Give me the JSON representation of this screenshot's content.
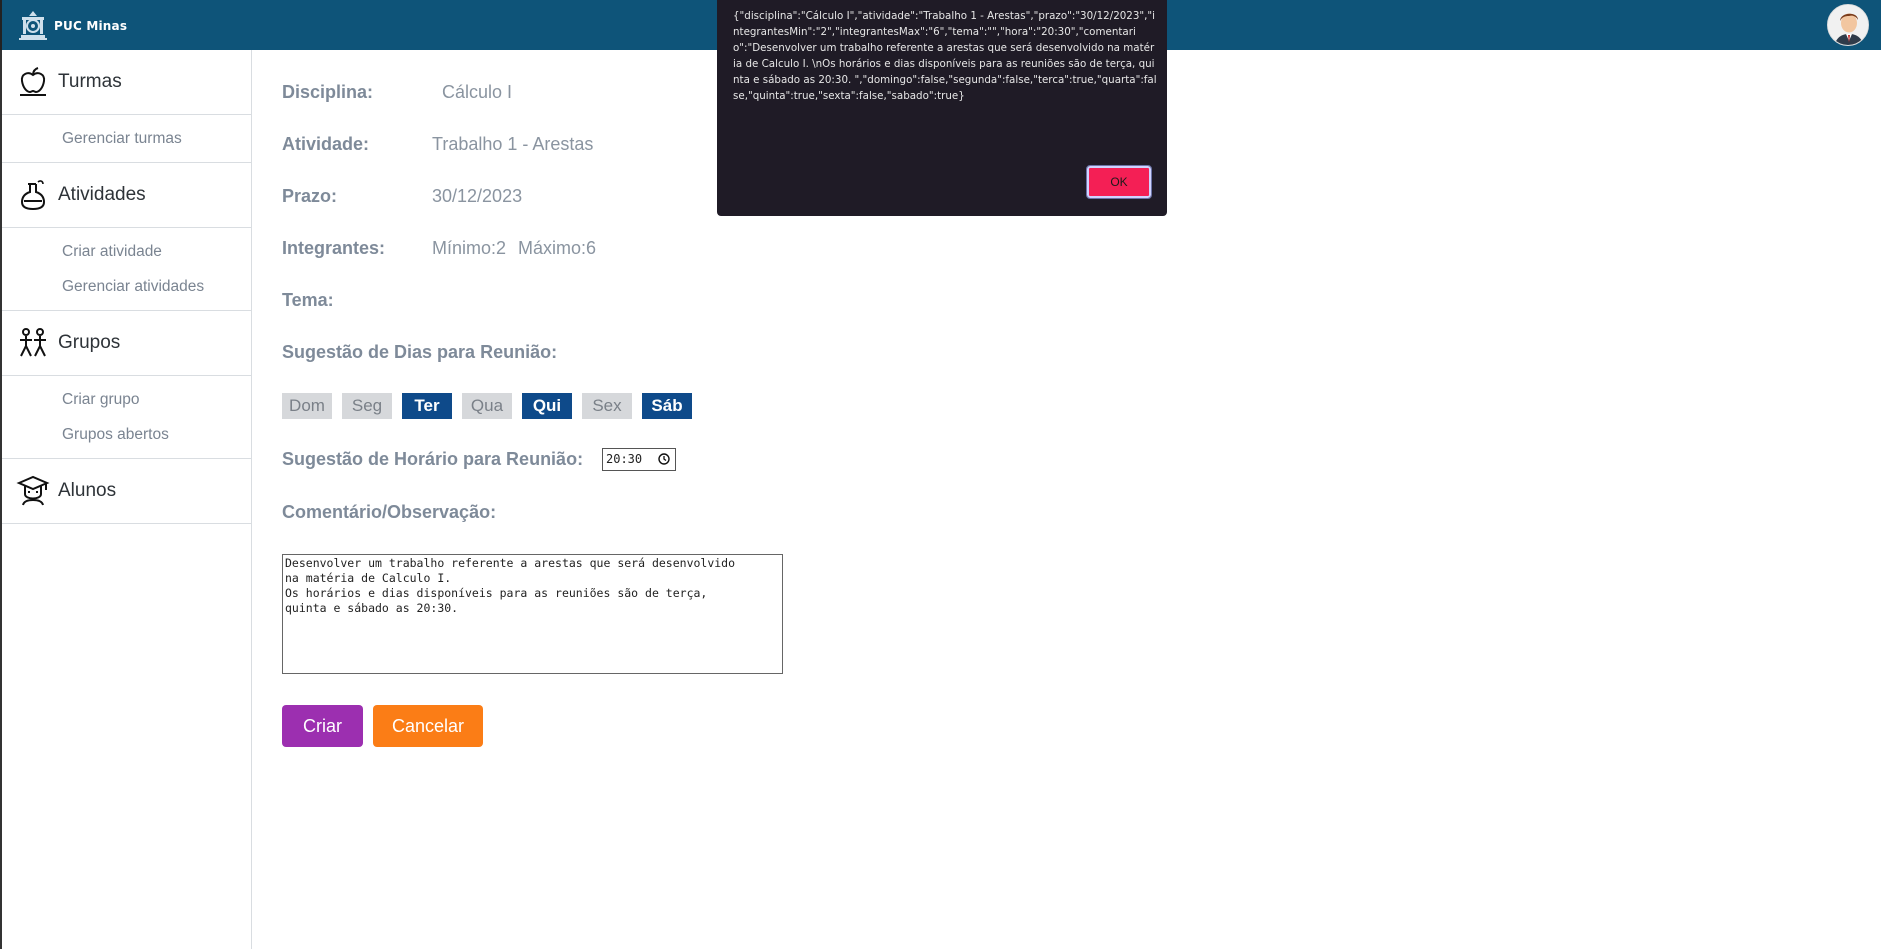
{
  "header": {
    "brand": "PUC Minas",
    "brand_logo": "puc-minas-crest-icon",
    "avatar": "user-avatar",
    "bar_color": "#0e5479"
  },
  "sidebar": {
    "sections": [
      {
        "label": "Turmas",
        "icon": "apple-icon",
        "items": [
          "Gerenciar turmas"
        ]
      },
      {
        "label": "Atividades",
        "icon": "flask-icon",
        "items": [
          "Criar atividade",
          "Gerenciar atividades"
        ]
      },
      {
        "label": "Grupos",
        "icon": "group-icon",
        "items": [
          "Criar grupo",
          "Grupos abertos"
        ]
      },
      {
        "label": "Alunos",
        "icon": "graduate-icon",
        "items": []
      }
    ]
  },
  "form": {
    "disciplina_label": "Disciplina:",
    "disciplina_value": "Cálculo I",
    "atividade_label": "Atividade:",
    "atividade_value": "Trabalho 1 - Arestas",
    "prazo_label": "Prazo:",
    "prazo_value": "30/12/2023",
    "integrantes_label": "Integrantes:",
    "integrantes_min": "Mínimo:2",
    "integrantes_max": "Máximo:6",
    "tema_label": "Tema:",
    "dias_label": "Sugestão de Dias para Reunião:",
    "days": [
      {
        "label": "Dom",
        "selected": false
      },
      {
        "label": "Seg",
        "selected": false
      },
      {
        "label": "Ter",
        "selected": true
      },
      {
        "label": "Qua",
        "selected": false
      },
      {
        "label": "Qui",
        "selected": true
      },
      {
        "label": "Sex",
        "selected": false
      },
      {
        "label": "Sáb",
        "selected": true
      }
    ],
    "horario_label": "Sugestão de Horário para Reunião:",
    "horario_value": "20:30",
    "comentario_label": "Comentário/Observação:",
    "comentario_value": "Desenvolver um trabalho referente a arestas que será desenvolvido\nna matéria de Calculo I.\nOs horários e dias disponíveis para as reuniões são de terça,\nquinta e sábado as 20:30.",
    "criar_label": "Criar",
    "cancelar_label": "Cancelar",
    "selected_day_color": "#0e4a8a",
    "criar_color": "#9c2fb0",
    "cancelar_color": "#fb7d16"
  },
  "dialog": {
    "message": "{\"disciplina\":\"Cálculo I\",\"atividade\":\"Trabalho 1 - Arestas\",\"prazo\":\"30/12/2023\",\"integrantesMin\":\"2\",\"integrantesMax\":\"6\",\"tema\":\"\",\"hora\":\"20:30\",\"comentario\":\"Desenvolver um trabalho referente a arestas que será desenvolvido na matéria de Calculo I. \\nOs horários e dias disponíveis para as reuniões são de terça, quinta e sábado as 20:30. \",\"domingo\":false,\"segunda\":false,\"terca\":true,\"quarta\":false,\"quinta\":true,\"sexta\":false,\"sabado\":true}",
    "ok_label": "OK",
    "ok_color": "#f41f55"
  }
}
